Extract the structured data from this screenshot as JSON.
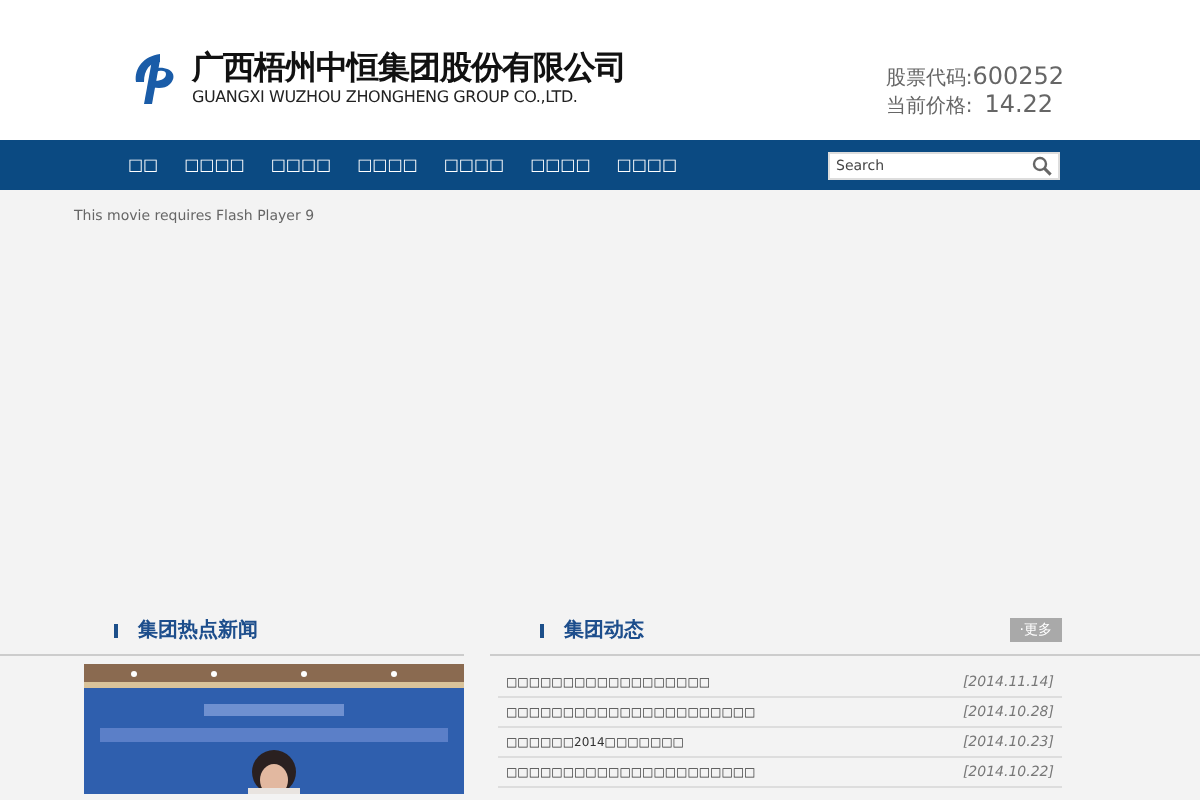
{
  "header": {
    "company_name": "广西梧州中恒集团股份有限公司",
    "company_name_en": "GUANGXI WUZHOU ZHONGHENG GROUP CO.,LTD.",
    "stock_code_label": "股票代码:",
    "stock_code": "600252",
    "price_label": "当前价格:",
    "price": "14.22"
  },
  "nav": {
    "items": [
      {
        "label": "□□"
      },
      {
        "label": "□□□□"
      },
      {
        "label": "□□□□"
      },
      {
        "label": "□□□□"
      },
      {
        "label": "□□□□"
      },
      {
        "label": "□□□□"
      },
      {
        "label": "□□□□"
      }
    ],
    "search": {
      "placeholder": "Search"
    }
  },
  "flash_notice": "This movie requires Flash Player 9",
  "hot_news": {
    "title": "集团热点新闻"
  },
  "group_news": {
    "title": "集团动态",
    "more": "·更多",
    "items": [
      {
        "title": "□□□□□□□□□□□□□□□□□□",
        "date": "[2014.11.14]"
      },
      {
        "title": "□□□□□□□□□□□□□□□□□□□□□□",
        "date": "[2014.10.28]"
      },
      {
        "title": "□□□□□□2014□□□□□□□",
        "date": "[2014.10.23]"
      },
      {
        "title": "□□□□□□□□□□□□□□□□□□□□□□",
        "date": "[2014.10.22]"
      }
    ]
  }
}
